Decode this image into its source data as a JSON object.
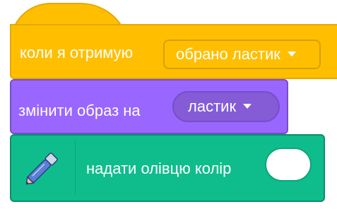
{
  "hat_block": {
    "label": "коли я отримую",
    "dropdown": "обрано ластик"
  },
  "looks_block": {
    "label": "змінити образ на",
    "dropdown": "ластик"
  },
  "pen_block": {
    "label": "надати олівцю колір",
    "icon": "pen-icon",
    "color_value": "#ffffff"
  },
  "colors": {
    "events": "#FFBF00",
    "looks": "#9966FF",
    "pen": "#0FBD8C"
  }
}
